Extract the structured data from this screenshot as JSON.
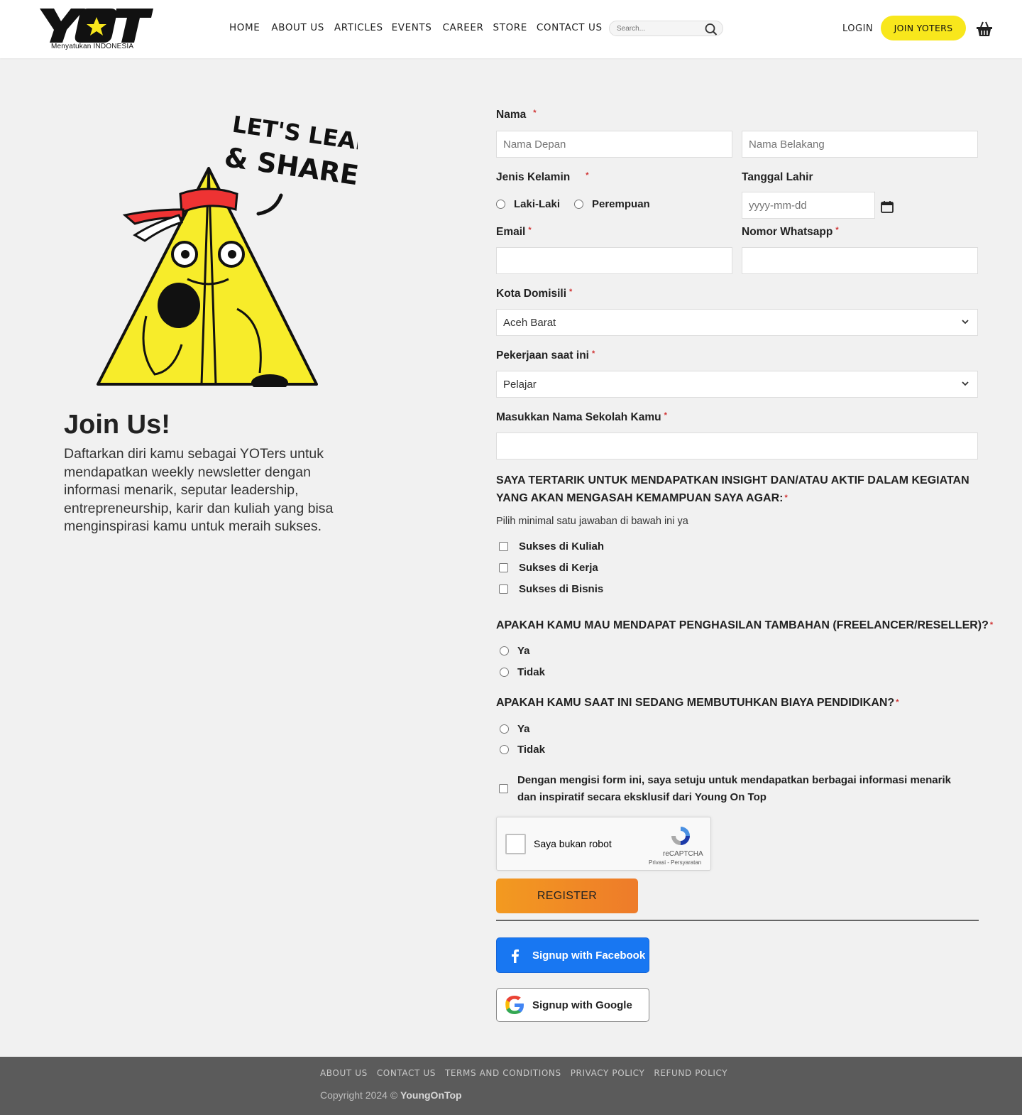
{
  "header": {
    "logo_text": "YOT",
    "tagline": "Menyatukan INDONESIA",
    "nav": [
      "HOME",
      "ABOUT US",
      "ARTICLES",
      "EVENTS",
      "CAREER",
      "STORE",
      "CONTACT US"
    ],
    "search_placeholder": "Search...",
    "login": "LOGIN",
    "join": "JOIN YOTERS",
    "brand_yellow": "#f8e71c"
  },
  "hero": {
    "speech_line1": "LET'S LEARN",
    "speech_line2": "& SHARE!",
    "title": "Join Us!",
    "description": "Daftarkan diri kamu sebagai YOTers untuk mendapatkan weekly newsletter dengan informasi menarik, seputar leadership, entrepreneurship, karir dan kuliah yang bisa menginspirasi kamu untuk meraih sukses."
  },
  "form": {
    "nama_label": "Nama",
    "nama_depan_placeholder": "Nama Depan",
    "nama_belakang_placeholder": "Nama Belakang",
    "gender_label": "Jenis Kelamin",
    "gender_options": [
      "Laki-Laki",
      "Perempuan"
    ],
    "dob_label": "Tanggal Lahir",
    "dob_placeholder": "yyyy-mm-dd",
    "email_label": "Email",
    "whatsapp_label": "Nomor Whatsapp",
    "kota_label": "Kota Domisili",
    "kota_value": "Aceh Barat",
    "pekerjaan_label": "Pekerjaan saat ini",
    "pekerjaan_value": "Pelajar",
    "sekolah_label": "Masukkan Nama Sekolah Kamu",
    "interest_question": "SAYA TERTARIK UNTUK MENDAPATKAN INSIGHT DAN/ATAU AKTIF DALAM KEGIATAN YANG AKAN MENGASAH KEMAMPUAN SAYA AGAR:",
    "interest_hint": "Pilih minimal satu jawaban di bawah ini ya",
    "interest_options": [
      "Sukses di Kuliah",
      "Sukses di Kerja",
      "Sukses di Bisnis"
    ],
    "income_question": "APAKAH KAMU MAU MENDAPAT PENGHASILAN TAMBAHAN (FREELANCER/RESELLER)?",
    "income_options": [
      "Ya",
      "Tidak"
    ],
    "edu_question": "APAKAH KAMU SAAT INI SEDANG MEMBUTUHKAN BIAYA PENDIDIKAN?",
    "edu_options": [
      "Ya",
      "Tidak"
    ],
    "consent": "Dengan mengisi form ini, saya setuju untuk mendapatkan berbagai informasi menarik dan inspiratif secara eksklusif dari Young On Top",
    "captcha_label": "Saya bukan robot",
    "captcha_brand": "reCAPTCHA",
    "captcha_terms": "Privasi - Persyaratan",
    "register": "REGISTER",
    "facebook": "Signup with Facebook",
    "google": "Signup with Google",
    "required_mark": "*"
  },
  "footer": {
    "links": [
      "ABOUT US",
      "CONTACT US",
      "TERMS AND CONDITIONS",
      "PRIVACY POLICY",
      "REFUND POLICY"
    ],
    "copyright_prefix": "Copyright 2024 ©",
    "brand": "YoungOnTop"
  }
}
